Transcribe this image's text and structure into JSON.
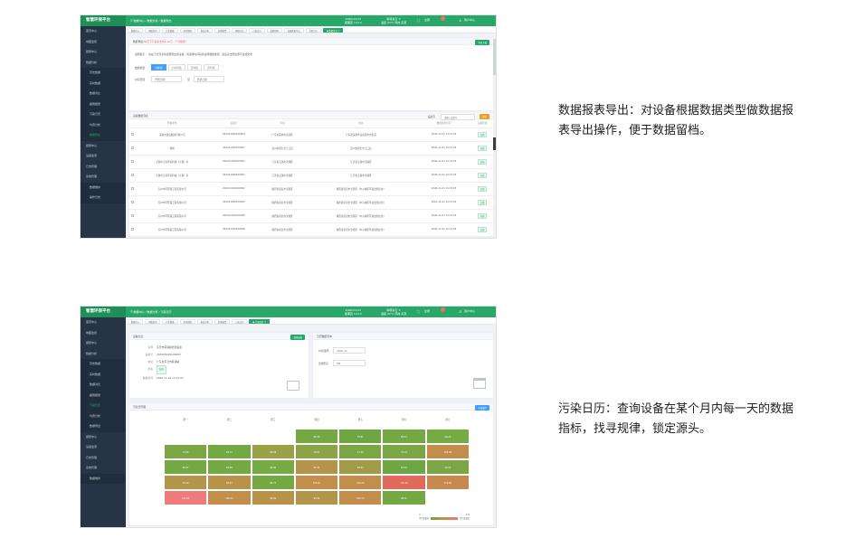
{
  "brand": "智慧环保平台",
  "shot1": {
    "breadcrumb": "☰  数据中心 / 数据分析 / 数据导出",
    "time": "2020/11/13\n星期四 14:13",
    "weather": "晴转多云 ☀\n温度 22°C 风向 东南",
    "fullscreen": "全屏",
    "user": "用户中心",
    "sidebar": [
      "首页中心",
      "地图监控",
      "报警中心",
      "数据分析",
      "历史数据",
      "实时数据",
      "数据对比",
      "超限报警",
      "污染日历",
      "均值分析",
      "数据导出",
      "报警中心",
      "设备监测",
      "日志管理",
      "系统管理",
      "数据维护",
      "操作日志"
    ],
    "sidebar_active": "数据导出",
    "tabs": [
      "数据中心",
      "地图监控",
      "历史数据",
      "实时数据",
      "报表分析",
      "超限报警",
      "数据对比",
      "污染日历",
      "设备管理",
      "设备数据导出",
      "系统日志",
      "● 数据导出 ×"
    ],
    "hint_prefix": "数据导出",
    "hint_red": "(每天下午最多支持5-10万 · 个月数据)",
    "export_btn": "导出下载",
    "notice_label": "说明提示",
    "notice_text": "先在下方列表勾选要导出的设备，再选择时间段并选择数据类型，最后点击导出即可生成文件",
    "type_label": "数据类型",
    "type_options": [
      "分钟值",
      "小时均值",
      "日均值",
      "月均值"
    ],
    "type_selected": "分钟值",
    "time_label": "时间范围",
    "date_start_ph": "开始日期",
    "date_sep": "至",
    "date_end_ph": "结束日期",
    "list_title": "设备数据列表",
    "search_label": "设备号",
    "search_ph": "请输入设备号",
    "search_btn": "搜索",
    "columns": [
      "所属单位",
      "设备号",
      "区域",
      "地址",
      "数据更新时间",
      "设备状态"
    ],
    "rows": [
      [
        "深圳市建设集团有限公司",
        "202011040100004",
        "广东省深圳市龙岗区",
        "广东省深圳市龙岗区布吉街道",
        "2020-11-01 14:15:03",
        "在线"
      ],
      [
        "鼎峰",
        "202011040100007",
        "贵州省铜仁市江口县",
        "贵州省铜仁市江口县",
        "2020-11-01 14:15:04",
        "在线"
      ],
      [
        "无锡市江南环境科技（无锡）有",
        "202011040100003",
        "江苏省无锡市滨湖区",
        "江苏省无锡市滨湖区",
        "2020-11-01 14:15:03",
        "在线"
      ],
      [
        "无锡市江南环境科技（无锡）有",
        "202011040100001",
        "江苏省无锡市滨湖区",
        "江苏省无锡市滨湖区",
        "2020-11-01 14:15:03",
        "在线"
      ],
      [
        "苏州中环环保工程有限公司",
        "202011040100002",
        "陕西省延安市宝塔区",
        "陕西省延安市宝塔区（中心城区环境监测点位）",
        "2020-11-01 14:15:03",
        "在线"
      ],
      [
        "苏州中环环保工程有限公司",
        "202011040100005",
        "陕西省延安市宝塔区",
        "陕西省延安市宝塔区（中心城区环境监测点位）",
        "2020-11-01 14:15:03",
        "在线"
      ],
      [
        "苏州中环环保工程有限公司",
        "202011040100006",
        "陕西省延安市宝塔区",
        "陕西省延安市宝塔区（中心城区环境监测点位）",
        "2020-11-01 14:15:03",
        "在线"
      ],
      [
        "苏州中环环保工程有限公司",
        "202011040100008",
        "陕西省延安市宝塔区",
        "陕西省延安市宝塔区（中心城区环境监测点位）",
        "2020-11-01 14:15:03",
        "在线"
      ],
      [
        "东莞·鼎莱",
        "202010230100003",
        "广东省东莞市麻涌镇",
        "广东省东莞市麻涌镇",
        "2020-11-01 14:15:07",
        "在线"
      ]
    ]
  },
  "desc1": "数据报表导出：对设备根据数据类型做数据报表导出操作，便于数据留档。",
  "shot2": {
    "breadcrumb": "☰  数据中心 / 数据分析 / 污染日历",
    "time": "2020/11/13\n星期四 14:13",
    "weather": "晴转多云 ☀\n温度 22°C 风向 东南",
    "fullscreen": "全屏",
    "user": "用户中心",
    "sidebar": [
      "首页中心",
      "地图监控",
      "报警中心",
      "数据分析",
      "历史数据",
      "实时数据",
      "数据对比",
      "超限报警",
      "污染日历",
      "均值分析",
      "数据导出",
      "报警中心",
      "设备监测",
      "日志管理",
      "系统管理",
      "数据维护"
    ],
    "sidebar_active": "污染日历",
    "tabs": [
      "数据中心",
      "地图监控",
      "历史数据",
      "实时数据",
      "报表分析",
      "超限报警",
      "污染日历",
      "● 污染日历 ×"
    ],
    "device_title": "设备信息",
    "select_btn": "选择设备",
    "device_fields": [
      {
        "label": "名称",
        "value": "东莞市麻涌镇监测设备"
      },
      {
        "label": "设备号",
        "value": "202008240100003"
      },
      {
        "label": "地址",
        "value": "广东省东莞市麻涌镇"
      },
      {
        "label": "状态",
        "value": "在线"
      },
      {
        "label": "数据时间",
        "value": "2020-11-01 14:12:55"
      }
    ],
    "query_title": "日历数据查询",
    "month_label": "时间选择",
    "month_value": "2020-11",
    "metric_label": "监测因子",
    "metric_value": "PM",
    "cal_title": "污染日历图",
    "cal_btn": "导出图片",
    "weekdays": [
      "周一",
      "周二",
      "周三",
      "周四",
      "周五",
      "周六",
      "周日"
    ],
    "days": [
      {
        "v": "",
        "c": ""
      },
      {
        "v": "",
        "c": ""
      },
      {
        "v": "",
        "c": ""
      },
      {
        "v": "68.30",
        "c": "#74a843"
      },
      {
        "v": "75.81",
        "c": "#6ea644"
      },
      {
        "v": "68.47",
        "c": "#74a843"
      },
      {
        "v": "66.20",
        "c": "#76aa43"
      },
      {
        "v": "74.46",
        "c": "#7aa744"
      },
      {
        "v": "68.72",
        "c": "#74a843"
      },
      {
        "v": "80.58",
        "c": "#9aa046"
      },
      {
        "v": "78.91",
        "c": "#8ca346"
      },
      {
        "v": "71.15",
        "c": "#7aa744"
      },
      {
        "v": "73.22",
        "c": "#78a744"
      },
      {
        "v": "102.48",
        "c": "#c38d4b"
      },
      {
        "v": "69.47",
        "c": "#74a843"
      },
      {
        "v": "69.58",
        "c": "#74a843"
      },
      {
        "v": "66.46",
        "c": "#76aa43"
      },
      {
        "v": "95.24",
        "c": "#b4944a"
      },
      {
        "v": "85.94",
        "c": "#a19b47"
      },
      {
        "v": "63.16",
        "c": "#6ea644"
      },
      {
        "v": "72.00",
        "c": "#7aa744"
      },
      {
        "v": "95.26",
        "c": "#b4944a"
      },
      {
        "v": "98.51",
        "c": "#b89249"
      },
      {
        "v": "68.73",
        "c": "#74a843"
      },
      {
        "v": "105.65",
        "c": "#c38d4b"
      },
      {
        "v": "106.46",
        "c": "#c38d4b"
      },
      {
        "v": "176.50",
        "c": "#e06a5c"
      },
      {
        "v": "116.83",
        "c": "#c8894c"
      },
      {
        "v": "221.60",
        "c": "#ef7a7a"
      },
      {
        "v": "106.34",
        "c": "#c38d4b"
      },
      {
        "v": "98.69",
        "c": "#b89249"
      },
      {
        "v": "93.40",
        "c": "#b4944a"
      },
      {
        "v": "106.72",
        "c": "#c38d4b"
      },
      {
        "v": "68.61",
        "c": "#74a843"
      },
      {
        "v": "",
        "c": ""
      }
    ],
    "legend_low": "0",
    "legend_high": "270",
    "legend_low_label": "空气质量优",
    "legend_high_label": "空气质量差"
  },
  "desc2": "污染日历：查询设备在某个月内每一天的数据指标，找寻规律，锁定源头。"
}
